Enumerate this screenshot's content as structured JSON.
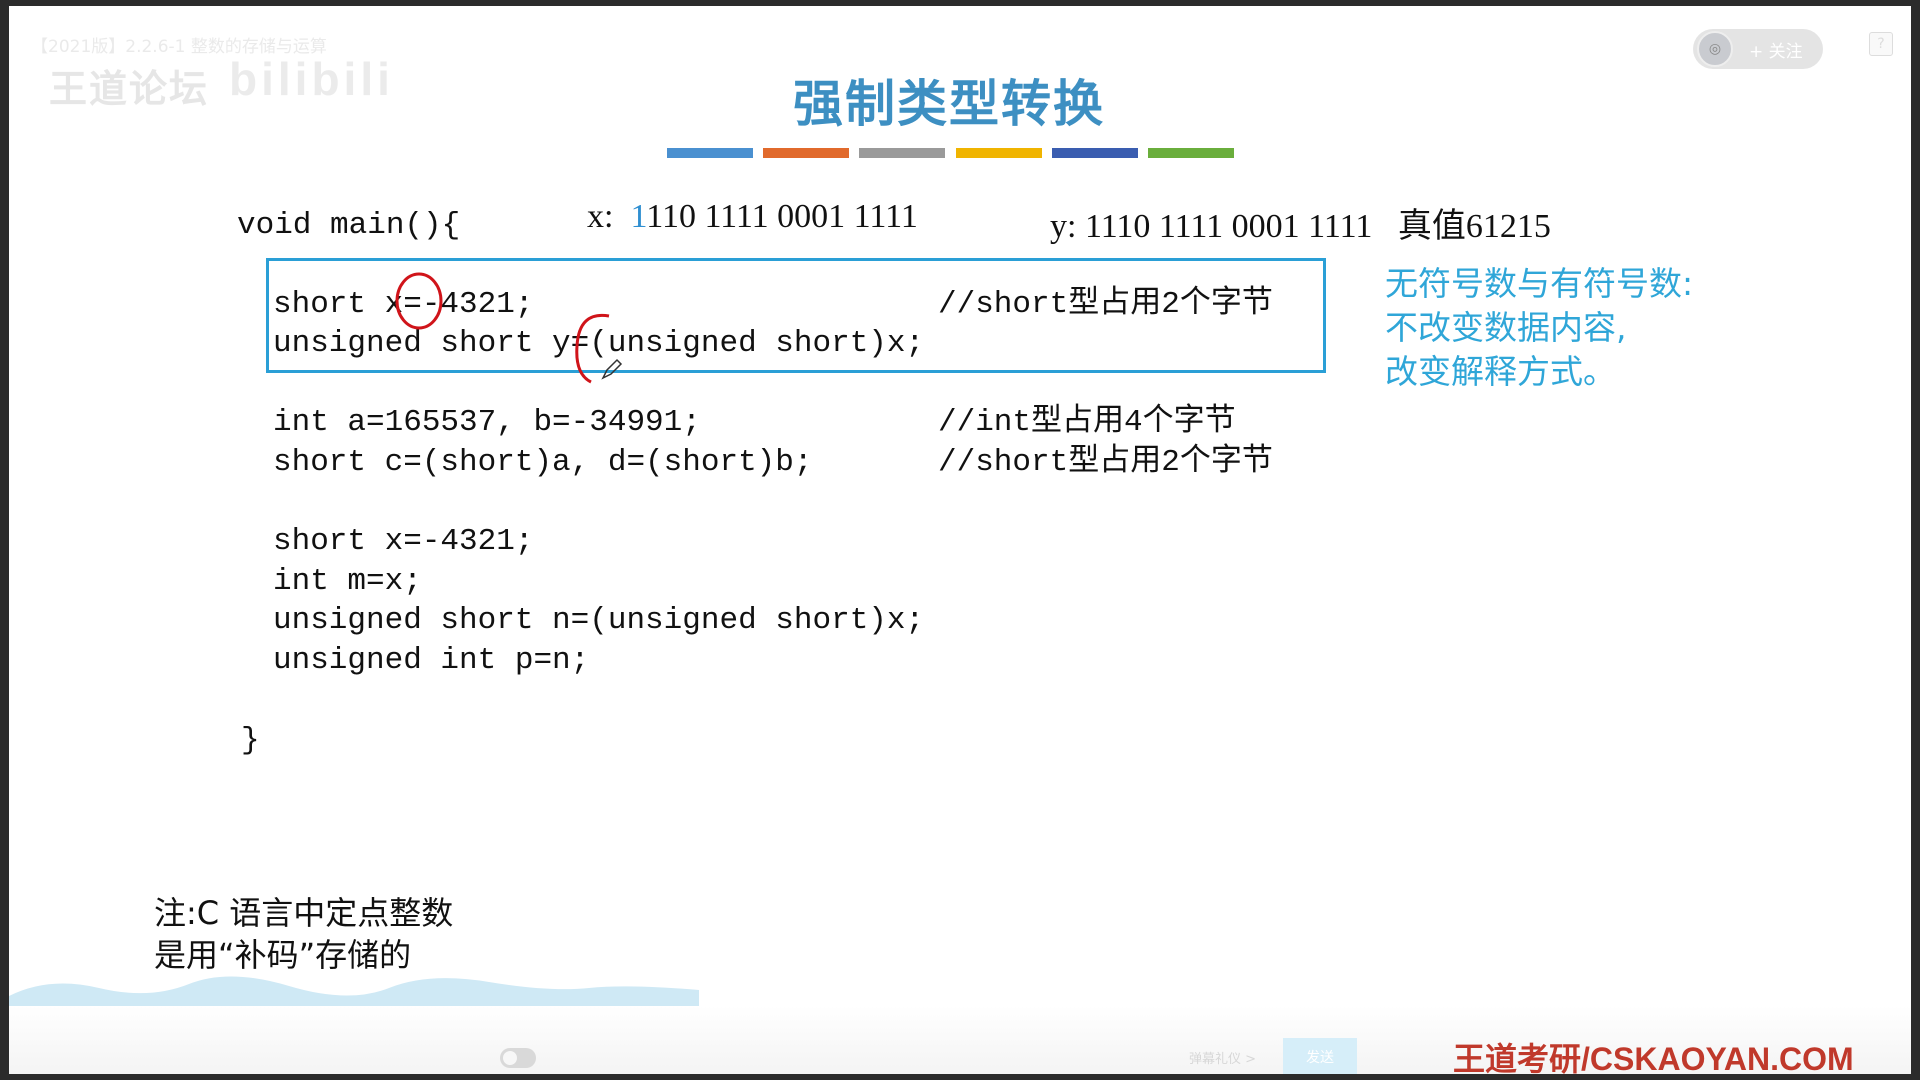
{
  "player": {
    "video_title": "【2021版】2.2.6-1  整数的存储与运算",
    "watermark_left": "王道论坛",
    "watermark_right": "bilibili",
    "follow_label": "+ 关注",
    "help_label": "?"
  },
  "slide": {
    "title": "强制类型转换",
    "color_bar_colors": [
      "#4a90d0",
      "#e16a2c",
      "#9a9a9a",
      "#f0b400",
      "#3a5db0",
      "#6aae3c"
    ],
    "main_open": "void main(){",
    "x_label": "x:",
    "x_first_bit": "1",
    "x_bits_rest": "110 1111 0001 1111",
    "y_label": "y:",
    "y_bits": "1110 1111 0001 1111",
    "true_value": "真值61215",
    "box_line1_code": "short x=-4321;",
    "box_line1_comment": "//short型占用2个字节",
    "box_line2_code": "unsigned short y=(unsigned short)x;",
    "line3_code": "int a=165537, b=-34991;",
    "line3_comment": "//int型占用4个字节",
    "line4_code": "short c=(short)a, d=(short)b;",
    "line4_comment": "//short型占用2个字节",
    "line5": "short x=-4321;",
    "line6": "int m=x;",
    "line7": "unsigned short n=(unsigned short)x;",
    "line8": "unsigned int p=n;",
    "main_close": "}",
    "side_note_line1": "无符号数与有符号数:",
    "side_note_line2": "不改变数据内容,",
    "side_note_line3": "改变解释方式。",
    "note_line1": "注:C 语言中定点整数",
    "note_line2": "是用“补码”存储的",
    "accent_color": "#2fa6d8"
  },
  "bottom": {
    "danmu_hint": "弹幕礼仪 >",
    "send_label": "发送",
    "brand": "王道考研/CSKAOYAN.COM"
  }
}
